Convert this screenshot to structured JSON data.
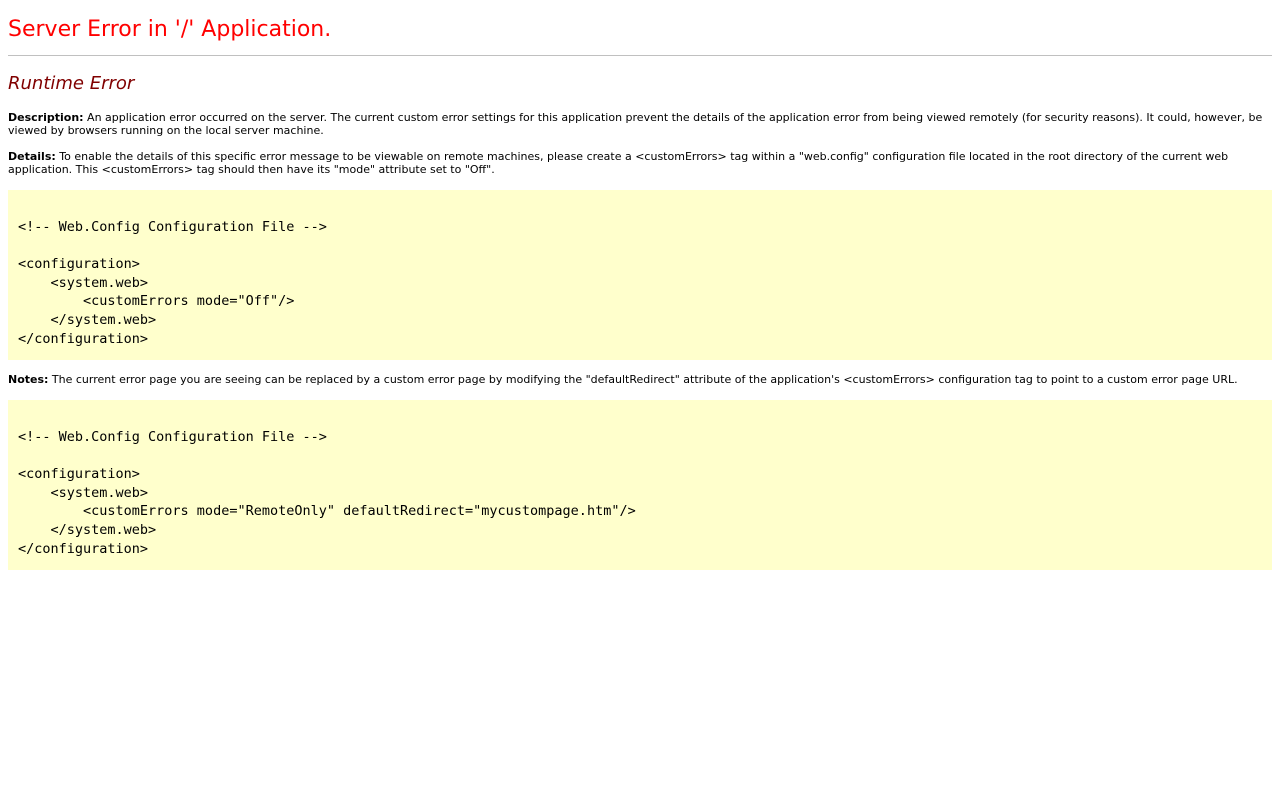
{
  "header": {
    "title": "Server Error in '/' Application.",
    "subtitle": "Runtime Error"
  },
  "description": {
    "label": "Description:",
    "text": " An application error occurred on the server. The current custom error settings for this application prevent the details of the application error from being viewed remotely (for security reasons). It could, however, be viewed by browsers running on the local server machine."
  },
  "details": {
    "label": "Details:",
    "text": " To enable the details of this specific error message to be viewable on remote machines, please create a <customErrors> tag within a \"web.config\" configuration file located in the root directory of the current web application. This <customErrors> tag should then have its \"mode\" attribute set to \"Off\"."
  },
  "code1": {
    "lines": [
      "<!-- Web.Config Configuration File -->",
      "",
      "<configuration>",
      "    <system.web>",
      "        <customErrors mode=\"Off\"/>",
      "    </system.web>",
      "</configuration>"
    ]
  },
  "notes": {
    "label": "Notes:",
    "text": " The current error page you are seeing can be replaced by a custom error page by modifying the \"defaultRedirect\" attribute of the application's <customErrors> configuration tag to point to a custom error page URL."
  },
  "code2": {
    "lines": [
      "<!-- Web.Config Configuration File -->",
      "",
      "<configuration>",
      "    <system.web>",
      "        <customErrors mode=\"RemoteOnly\" defaultRedirect=\"mycustompage.htm\"/>",
      "    </system.web>",
      "</configuration>"
    ]
  }
}
